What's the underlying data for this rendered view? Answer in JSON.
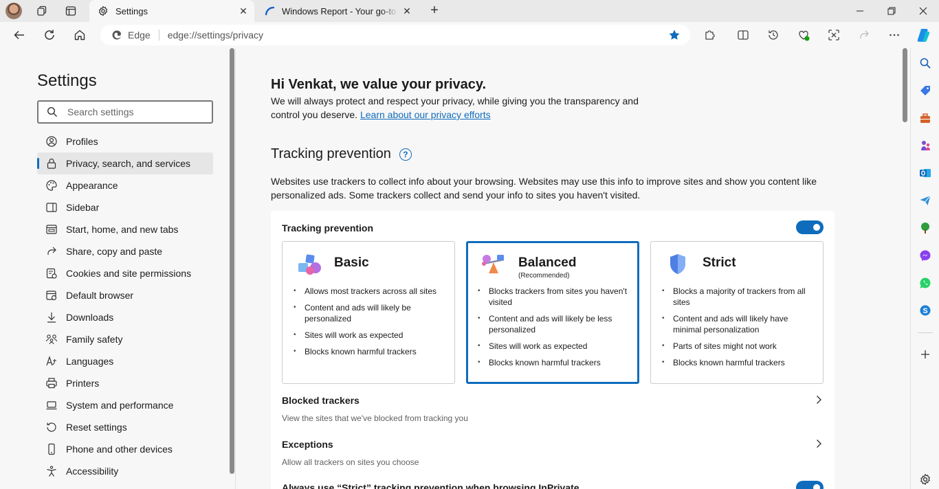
{
  "tabs": [
    {
      "title": "Settings",
      "active": true
    },
    {
      "title": "Windows Report - Your go-to source",
      "active": false
    }
  ],
  "address": {
    "site_label": "Edge",
    "url": "edge://settings/privacy"
  },
  "sidebar": {
    "title": "Settings",
    "search_placeholder": "Search settings",
    "items": [
      {
        "label": "Profiles",
        "icon": "profile-icon"
      },
      {
        "label": "Privacy, search, and services",
        "icon": "lock-icon",
        "selected": true
      },
      {
        "label": "Appearance",
        "icon": "appearance-icon"
      },
      {
        "label": "Sidebar",
        "icon": "sidebar-icon"
      },
      {
        "label": "Start, home, and new tabs",
        "icon": "home-tabs-icon"
      },
      {
        "label": "Share, copy and paste",
        "icon": "share-icon"
      },
      {
        "label": "Cookies and site permissions",
        "icon": "cookies-icon"
      },
      {
        "label": "Default browser",
        "icon": "default-browser-icon"
      },
      {
        "label": "Downloads",
        "icon": "download-icon"
      },
      {
        "label": "Family safety",
        "icon": "family-icon"
      },
      {
        "label": "Languages",
        "icon": "languages-icon"
      },
      {
        "label": "Printers",
        "icon": "printer-icon"
      },
      {
        "label": "System and performance",
        "icon": "laptop-icon"
      },
      {
        "label": "Reset settings",
        "icon": "reset-icon"
      },
      {
        "label": "Phone and other devices",
        "icon": "phone-icon"
      },
      {
        "label": "Accessibility",
        "icon": "accessibility-icon"
      }
    ]
  },
  "main": {
    "greeting": "Hi Venkat, we value your privacy.",
    "greeting_sub": "We will always protect and respect your privacy, while giving you the transparency and control you deserve.",
    "privacy_link": "Learn about our privacy efforts",
    "tracking": {
      "section_title": "Tracking prevention",
      "description": "Websites use trackers to collect info about your browsing. Websites may use this info to improve sites and show you content like personalized ads. Some trackers collect and send your info to sites you haven't visited.",
      "toggle_label": "Tracking prevention",
      "enabled": true,
      "options": [
        {
          "title": "Basic",
          "recommended": "",
          "bullets": [
            "Allows most trackers across all sites",
            "Content and ads will likely be personalized",
            "Sites will work as expected",
            "Blocks known harmful trackers"
          ]
        },
        {
          "title": "Balanced",
          "recommended": "(Recommended)",
          "selected": true,
          "bullets": [
            "Blocks trackers from sites you haven't visited",
            "Content and ads will likely be less personalized",
            "Sites will work as expected",
            "Blocks known harmful trackers"
          ]
        },
        {
          "title": "Strict",
          "recommended": "",
          "bullets": [
            "Blocks a majority of trackers from all sites",
            "Content and ads will likely have minimal personalization",
            "Parts of sites might not work",
            "Blocks known harmful trackers"
          ]
        }
      ],
      "blocked_title": "Blocked trackers",
      "blocked_sub": "View the sites that we've blocked from tracking you",
      "exceptions_title": "Exceptions",
      "exceptions_sub": "Allow all trackers on sites you choose",
      "inprivate_title": "Always use “Strict” tracking prevention when browsing InPrivate"
    }
  },
  "colors": {
    "accent": "#0f6cbd",
    "bg": "#f7f7f7"
  }
}
